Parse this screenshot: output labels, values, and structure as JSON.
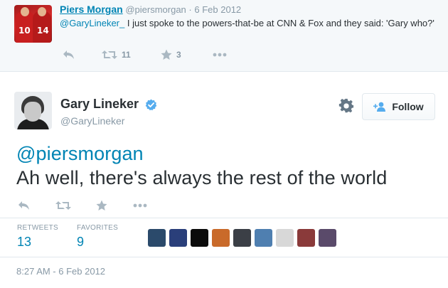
{
  "parent_tweet": {
    "name": "Piers Morgan",
    "handle": "@piersmorgan",
    "separator": "·",
    "date": "6 Feb 2012",
    "mention": "@GaryLineker_",
    "text": " I just spoke to the powers-that-be at CNN & Fox and they said: 'Gary who?'",
    "avatar_numbers": [
      "10",
      "14"
    ],
    "retweets": "11",
    "favorites": "3"
  },
  "main_tweet": {
    "name": "Gary Lineker",
    "handle": "@GaryLineker",
    "follow_label": "Follow",
    "mention": "@piersmorgan",
    "text": "Ah well, there's always the rest of the world",
    "stats": {
      "retweets_label": "RETWEETS",
      "retweets_value": "13",
      "favorites_label": "FAVORITES",
      "favorites_value": "9"
    },
    "favoriter_avatar_colors": [
      "#2b4a6b",
      "#2a3f7a",
      "#0b0b0b",
      "#c96a2a",
      "#3b3f46",
      "#4f7fb0",
      "#d8d8d8",
      "#8a3a3a",
      "#5a4a6a"
    ],
    "timestamp": "8:27 AM - 6 Feb 2012"
  },
  "colors": {
    "link": "#0084b4",
    "muted": "#8899a6",
    "icon": "#aab8c2",
    "verified": "#55acee",
    "parent_bg": "#f5f8fa"
  },
  "icons": [
    "reply-icon",
    "retweet-icon",
    "favorite-star-icon",
    "more-dots-icon",
    "verified-badge-icon",
    "gear-icon",
    "follow-person-plus-icon"
  ]
}
